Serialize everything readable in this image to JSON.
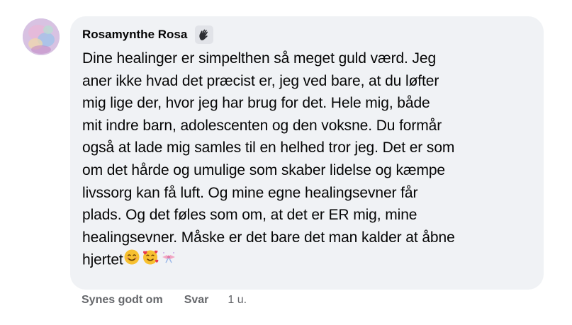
{
  "comment": {
    "author": "Rosamynthe Rosa",
    "badge_icon": "waving-hand-icon",
    "avatar_icon": "profile-avatar",
    "text": "Dine healinger er simpelthen så meget guld værd. Jeg\naner ikke hvad det præcist er, jeg ved bare, at du løfter\nmig lige der, hvor jeg har brug for det. Hele mig, både\nmit indre barn, adolescenten og den voksne. Du formår\nogså at lade mig samles til en helhed tror jeg. Det er som\nom det hårde og umulige som skaber lidelse og kæmpe\nlivssorg kan få luft. Og mine egne healingsevner får\nplads. Og det føles som om, at det er ER mig, mine\nhealingsevner. Måske er det bare det man kalder at åbne\nhjertet",
    "emojis": [
      "smiling-face-icon",
      "smiling-face-with-hearts-icon",
      "sparkle-ribbon-icon"
    ]
  },
  "actions": {
    "like_label": "Synes godt om",
    "reply_label": "Svar",
    "timestamp": "1 u."
  },
  "colors": {
    "bubble_bg": "#f0f2f5",
    "text": "#050505",
    "secondary_text": "#65676b"
  }
}
